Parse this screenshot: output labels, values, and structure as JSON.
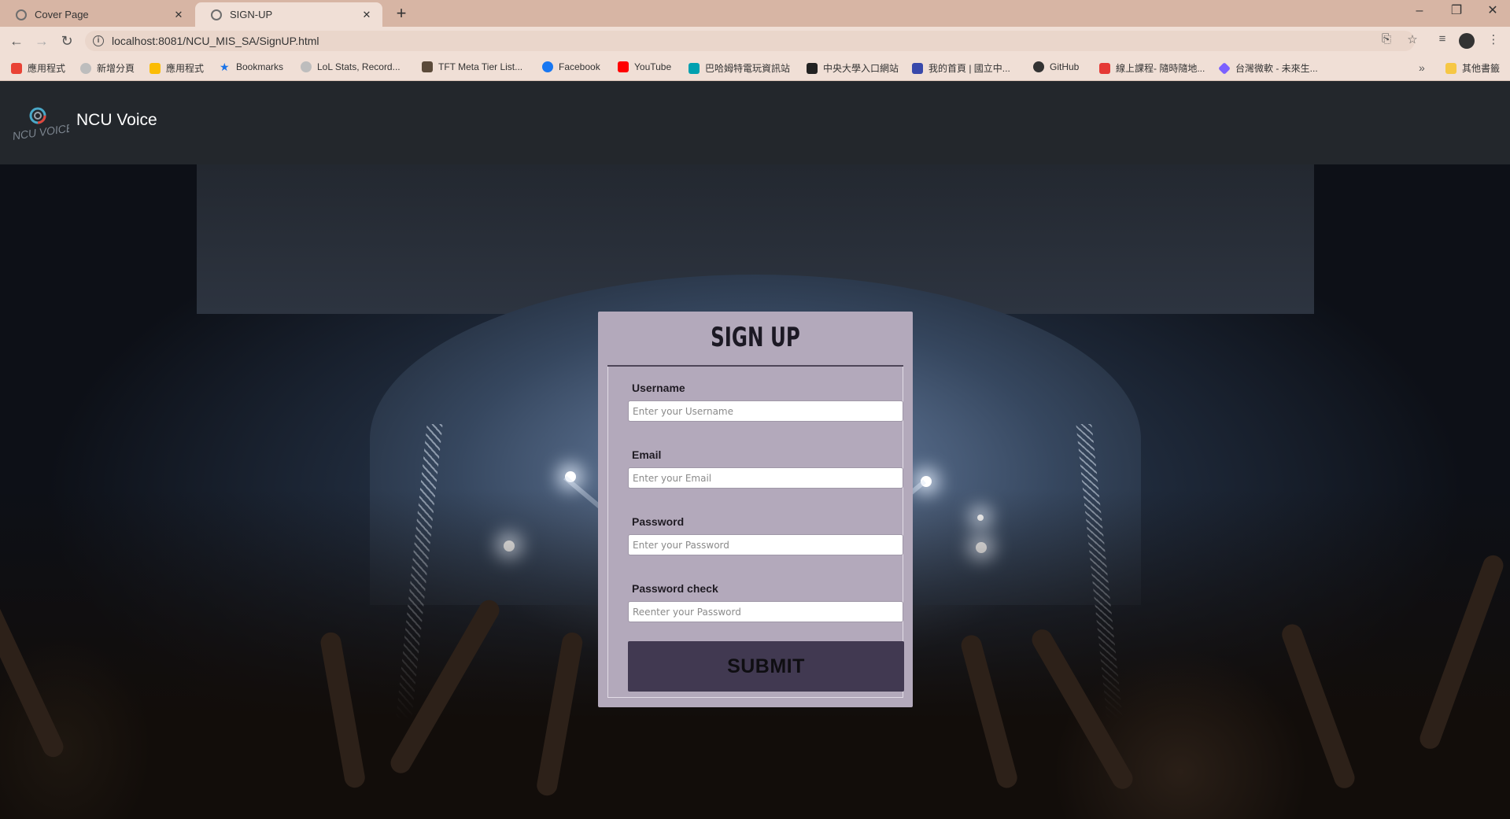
{
  "browser": {
    "tabs": [
      {
        "title": "Cover Page",
        "active": false
      },
      {
        "title": "SIGN-UP",
        "active": true
      }
    ],
    "url": "localhost:8081/NCU_MIS_SA/SignUP.html",
    "bookmarks": [
      {
        "label": "應用程式",
        "icon": "apps-grid-icon",
        "color": "#e94235"
      },
      {
        "label": "新增分頁",
        "icon": "globe-icon",
        "color": "#9e9e9e"
      },
      {
        "label": "應用程式",
        "icon": "apps-grid-icon",
        "color": "#fbbc04"
      },
      {
        "label": "Bookmarks",
        "icon": "star-icon",
        "color": "#1a73e8"
      },
      {
        "label": "LoL Stats, Record...",
        "icon": "globe-icon",
        "color": "#9e9e9e"
      },
      {
        "label": "TFT Meta Tier List...",
        "icon": "tft-icon",
        "color": "#5b4a3a"
      },
      {
        "label": "Facebook",
        "icon": "facebook-icon",
        "color": "#1877f2"
      },
      {
        "label": "YouTube",
        "icon": "youtube-icon",
        "color": "#ff0000"
      },
      {
        "label": "巴哈姆特電玩資訊站",
        "icon": "bahamut-icon",
        "color": "#00a0b0"
      },
      {
        "label": "中央大學入口網站",
        "icon": "ncu-portal-icon",
        "color": "#222222"
      },
      {
        "label": "我的首頁 | 國立中...",
        "icon": "moodle-icon",
        "color": "#3949ab"
      },
      {
        "label": "GitHub",
        "icon": "github-icon",
        "color": "#333333"
      },
      {
        "label": "線上課程- 隨時隨地...",
        "icon": "coursera-icon",
        "color": "#e53935"
      },
      {
        "label": "台灣微軟 - 未來生...",
        "icon": "microsoft-icon",
        "color": "#7b61ff"
      }
    ],
    "other_bookmarks": "其他書籤",
    "overflow": "»"
  },
  "site": {
    "brand": "NCU Voice",
    "logo_text": "NCU VOICE"
  },
  "form": {
    "title": "SIGN UP",
    "fields": [
      {
        "label": "Username",
        "placeholder": "Enter your Username",
        "value": ""
      },
      {
        "label": "Email",
        "placeholder": "Enter your Email",
        "value": ""
      },
      {
        "label": "Password",
        "placeholder": "Enter your Password",
        "value": ""
      },
      {
        "label": "Password check",
        "placeholder": "Reenter your Password",
        "value": ""
      }
    ],
    "submit_label": "SUBMIT"
  },
  "colors": {
    "tabstrip": "#d7b5a4",
    "toolbar": "#f0dfd6",
    "header": "#23272c",
    "card": "#b3a9bb",
    "submit": "#413951"
  }
}
